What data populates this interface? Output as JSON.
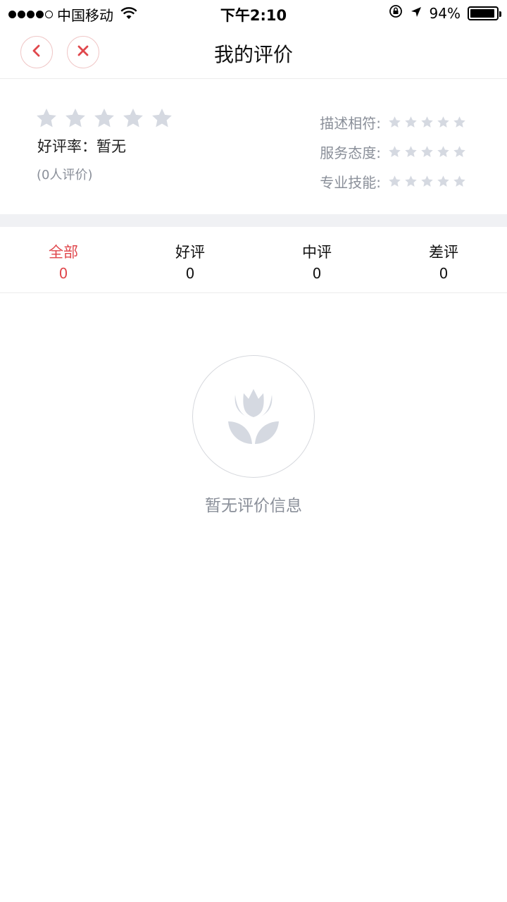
{
  "status_bar": {
    "carrier": "中国移动",
    "time": "下午2:10",
    "battery_text": "94%",
    "battery_level": 0.94,
    "icons": [
      "signal-dots",
      "wifi-icon",
      "rotation-lock-icon",
      "location-arrow-icon",
      "battery-icon"
    ]
  },
  "nav": {
    "title": "我的评价",
    "back_icon": "chevron-left-icon",
    "close_icon": "close-icon",
    "accent_color": "#e0474c"
  },
  "summary": {
    "overall_stars": 0,
    "rate_text": "好评率：暂无",
    "count_text": "(0人评价)",
    "sub_ratings": [
      {
        "label": "描述相符:",
        "stars": 0
      },
      {
        "label": "服务态度:",
        "stars": 0
      },
      {
        "label": "专业技能:",
        "stars": 0
      }
    ]
  },
  "tabs": [
    {
      "label": "全部",
      "count": "0",
      "active": true
    },
    {
      "label": "好评",
      "count": "0",
      "active": false
    },
    {
      "label": "中评",
      "count": "0",
      "active": false
    },
    {
      "label": "差评",
      "count": "0",
      "active": false
    }
  ],
  "empty_state": {
    "icon": "tulip-icon",
    "text": "暂无评价信息"
  },
  "colors": {
    "star_empty": "#d5d9e1",
    "muted_text": "#8a8f99",
    "band": "#f0f1f4"
  }
}
